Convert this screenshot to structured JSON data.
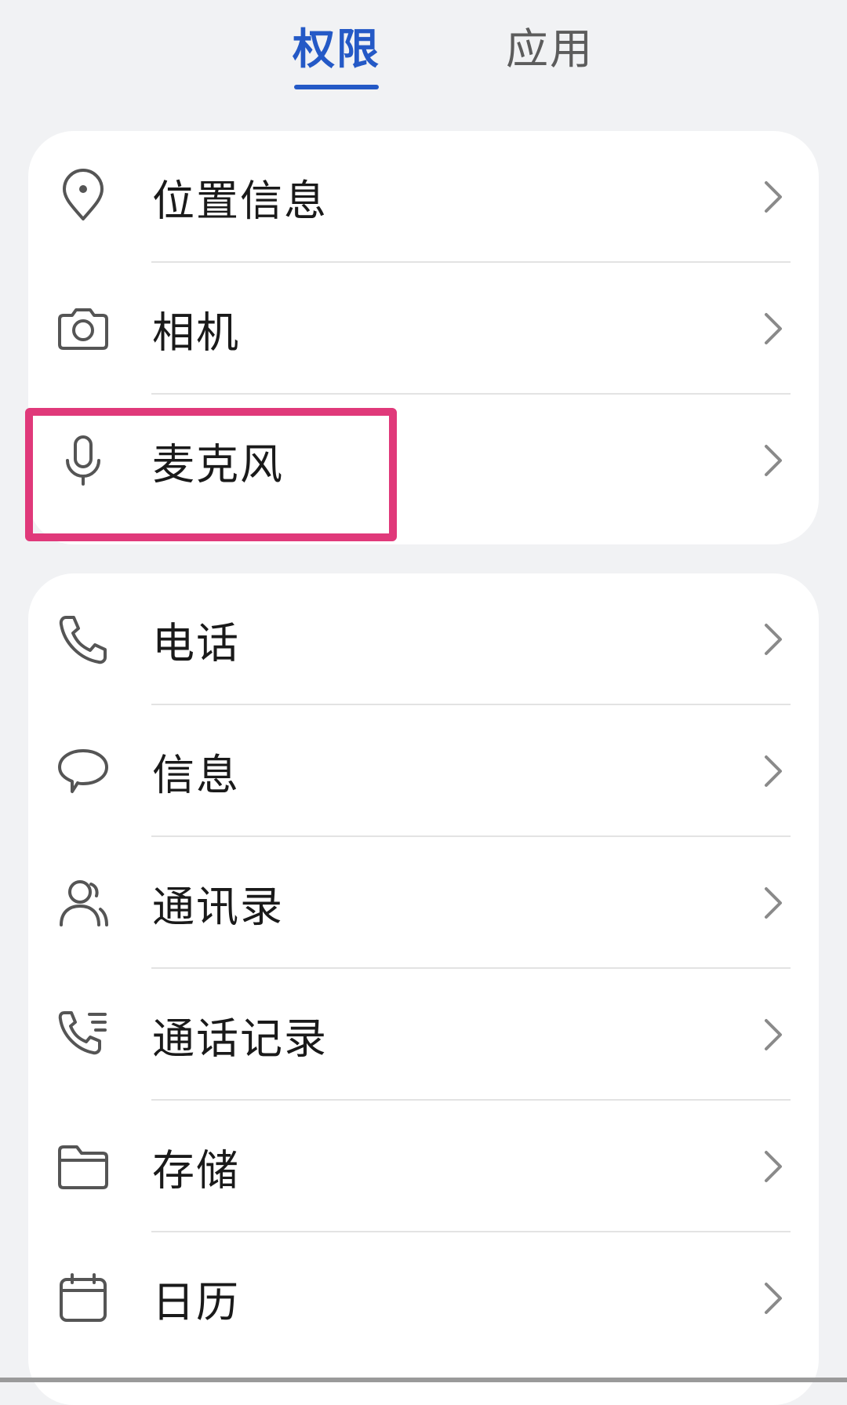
{
  "tabs": {
    "active_label": "权限",
    "inactive_label": "应用"
  },
  "groups": [
    {
      "items": [
        {
          "label": "位置信息",
          "icon": "location-pin-icon"
        },
        {
          "label": "相机",
          "icon": "camera-icon"
        },
        {
          "label": "麦克风",
          "icon": "microphone-icon"
        }
      ]
    },
    {
      "items": [
        {
          "label": "电话",
          "icon": "phone-icon"
        },
        {
          "label": "信息",
          "icon": "message-bubble-icon"
        },
        {
          "label": "通讯录",
          "icon": "contacts-icon"
        },
        {
          "label": "通话记录",
          "icon": "call-log-icon"
        },
        {
          "label": "存储",
          "icon": "folder-icon"
        },
        {
          "label": "日历",
          "icon": "calendar-icon"
        }
      ]
    }
  ],
  "colors": {
    "accent": "#2459c6",
    "highlight": "#e0397a",
    "background": "#f1f2f4",
    "card": "#ffffff"
  }
}
